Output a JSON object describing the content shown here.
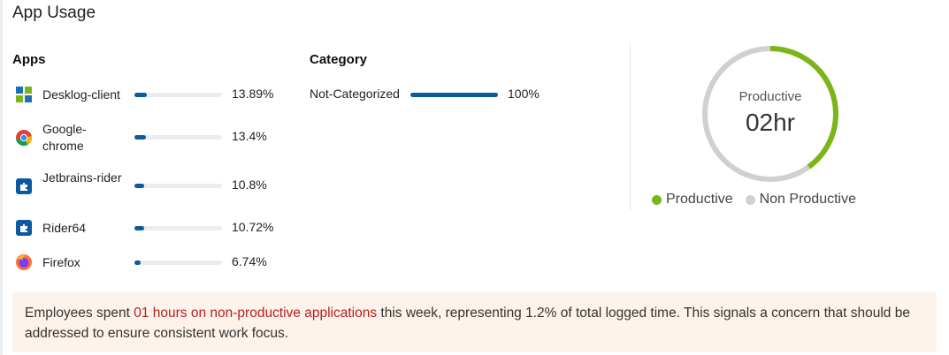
{
  "title": "App Usage",
  "apps_header": "Apps",
  "category_header": "Category",
  "apps": [
    {
      "name": "Desklog-client",
      "percent_label": "13.89%",
      "percent": 13.89,
      "icon": "desklog-icon"
    },
    {
      "name": "Google-chrome",
      "percent_label": "13.4%",
      "percent": 13.4,
      "icon": "chrome-icon"
    },
    {
      "name": "Jetbrains-rider",
      "percent_label": "10.8%",
      "percent": 10.8,
      "icon": "plugin-icon"
    },
    {
      "name": "Rider64",
      "percent_label": "10.72%",
      "percent": 10.72,
      "icon": "plugin-icon"
    },
    {
      "name": "Firefox",
      "percent_label": "6.74%",
      "percent": 6.74,
      "icon": "firefox-icon"
    }
  ],
  "categories": [
    {
      "name": "Not-Categorized",
      "percent_label": "100%",
      "percent": 100
    }
  ],
  "donut": {
    "label": "Productive",
    "value": "02hr",
    "productive_fraction": 0.4,
    "colors": {
      "productive": "#7cb518",
      "non_productive": "#d0d0d0"
    }
  },
  "legend": {
    "productive": "Productive",
    "non_productive": "Non Productive"
  },
  "notice": {
    "prefix": "Employees spent ",
    "highlight": "01 hours on non-productive applications",
    "suffix": " this week, representing 1.2% of total logged time. This signals a concern that should be addressed to ensure consistent work focus."
  },
  "colors": {
    "bar": "#0b5aa0",
    "highlight": "#b51f1f",
    "notice_bg": "#fdf3ea"
  }
}
